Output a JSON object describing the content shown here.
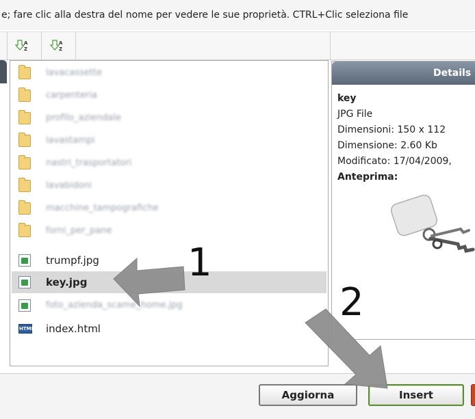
{
  "instructions": "e; fare clic alla destra del nome per vedere le sue proprietà. CTRL+Clic seleziona file",
  "toolbar": {
    "sort_buttons": [
      "sort-az-icon",
      "sort-az-icon"
    ]
  },
  "files": [
    {
      "name": "lavacassette",
      "type": "folder",
      "blurred": true
    },
    {
      "name": "carpenteria",
      "type": "folder",
      "blurred": true
    },
    {
      "name": "profilo_aziendale",
      "type": "folder",
      "blurred": true
    },
    {
      "name": "lavastampi",
      "type": "folder",
      "blurred": true
    },
    {
      "name": "nastri_trasportatori",
      "type": "folder",
      "blurred": true
    },
    {
      "name": "lavabidoni",
      "type": "folder",
      "blurred": true
    },
    {
      "name": "macchine_tampografiche",
      "type": "folder",
      "blurred": true
    },
    {
      "name": "forni_per_pane",
      "type": "folder",
      "blurred": true
    },
    {
      "name": "trumpf.jpg",
      "type": "image",
      "blurred": false
    },
    {
      "name": "key.jpg",
      "type": "image",
      "blurred": false,
      "selected": true
    },
    {
      "name": "foto_azienda_scame_home.jpg",
      "type": "image",
      "blurred": true
    },
    {
      "name": "index.html",
      "type": "html",
      "blurred": false
    }
  ],
  "details": {
    "header": "Details",
    "name": "key",
    "type": "JPG File",
    "dimensions": "Dimensioni: 150 x 112",
    "size": "Dimensione: 2.60 Kb",
    "modified": "Modificato: 17/04/2009,",
    "preview_label": "Anteprima:"
  },
  "buttons": {
    "refresh": "Aggiorna",
    "insert": "Insert"
  },
  "annotations": {
    "step1": "1",
    "step2": "2"
  },
  "colors": {
    "header_gradient_top": "#8896a6",
    "header_gradient_bottom": "#5b6878",
    "selected_row": "#d9d9d9",
    "insert_border": "#5b8a3a",
    "arrow": "#8a8a8a"
  }
}
